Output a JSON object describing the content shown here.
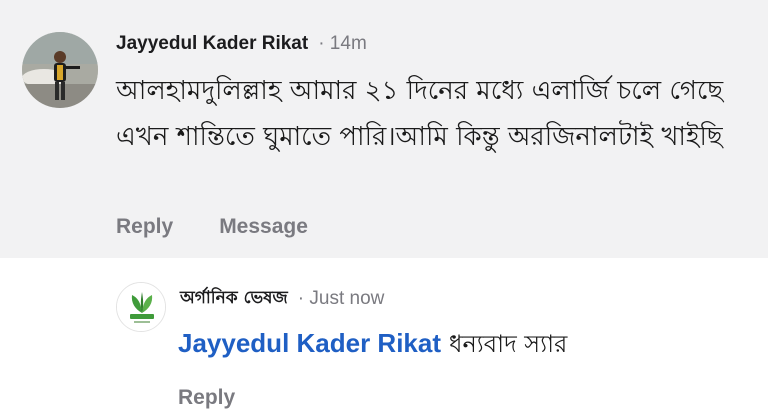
{
  "comment": {
    "author": "Jayyedul Kader Rikat",
    "time": "· 14m",
    "text": "আলহামদুলিল্লাহ আমার ২১ দিনের মধ্যে এলার্জি চলে গেছে এখন শান্তিতে ঘুমাতে পারি।আমি কিন্তু অরজিনালটাই খাইছি",
    "actions": {
      "reply": "Reply",
      "message": "Message"
    }
  },
  "reply": {
    "author": "অর্গানিক ভেষজ",
    "time": "· Just now",
    "mention": "Jayyedul Kader Rikat",
    "text": "ধন্যবাদ স্যার",
    "actions": {
      "reply": "Reply"
    }
  },
  "colors": {
    "mention": "#1f5fc4",
    "muted": "#7a7a80",
    "top_bg": "#f2f2f3"
  }
}
